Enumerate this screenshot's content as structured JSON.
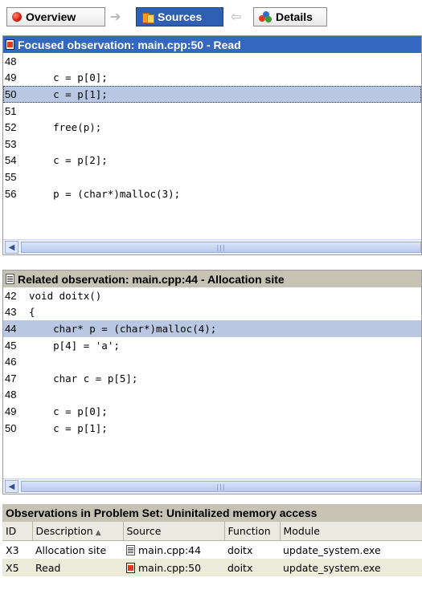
{
  "nav": {
    "overview": "Overview",
    "sources": "Sources",
    "details": "Details",
    "arrow_right": "➔",
    "arrow_left": "⇦"
  },
  "focused": {
    "title": "Focused observation: main.cpp:50 - Read",
    "lines": [
      {
        "n": "48",
        "code": ""
      },
      {
        "n": "49",
        "code": "    c = p[0];"
      },
      {
        "n": "50",
        "code": "    c = p[1];"
      },
      {
        "n": "51",
        "code": ""
      },
      {
        "n": "52",
        "code": "    free(p);"
      },
      {
        "n": "53",
        "code": ""
      },
      {
        "n": "54",
        "code": "    c = p[2];"
      },
      {
        "n": "55",
        "code": ""
      },
      {
        "n": "56",
        "code": "    p = (char*)malloc(3);"
      }
    ],
    "highlighted_line": "50"
  },
  "related": {
    "title": "Related observation: main.cpp:44 - Allocation site",
    "lines": [
      {
        "n": "42",
        "code": "void doitx()"
      },
      {
        "n": "43",
        "code": "{"
      },
      {
        "n": "44",
        "code": "    char* p = (char*)malloc(4);"
      },
      {
        "n": "45",
        "code": "    p[4] = 'a';"
      },
      {
        "n": "46",
        "code": ""
      },
      {
        "n": "47",
        "code": "    char c = p[5];"
      },
      {
        "n": "48",
        "code": ""
      },
      {
        "n": "49",
        "code": "    c = p[0];"
      },
      {
        "n": "50",
        "code": "    c = p[1];"
      }
    ],
    "highlighted_line": "44"
  },
  "observations": {
    "title": "Observations in Problem Set: Uninitalized memory access",
    "columns": [
      "ID",
      "Description",
      "Source",
      "Function",
      "Module"
    ],
    "rows": [
      {
        "id": "X3",
        "description": "Allocation site",
        "source": "main.cpp:44",
        "function": "doitx",
        "module": "update_system.exe",
        "icon": "gray-doc-icon"
      },
      {
        "id": "X5",
        "description": "Read",
        "source": "main.cpp:50",
        "function": "doitx",
        "module": "update_system.exe",
        "icon": "red-doc-icon"
      }
    ]
  },
  "colors": {
    "focused_title_bg": "#3468c0",
    "related_title_bg": "#c6c3b5",
    "highlight": "#b9c7e2"
  }
}
